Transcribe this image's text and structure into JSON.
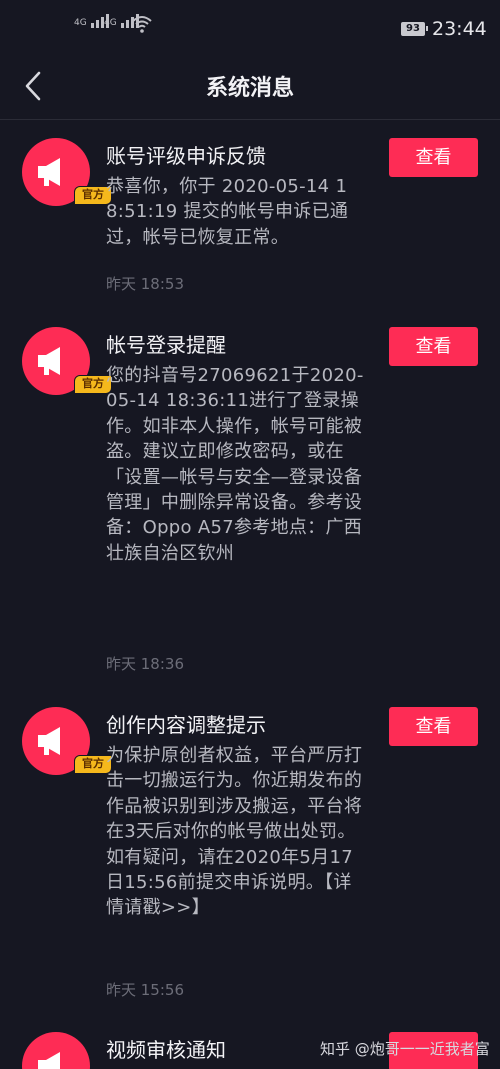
{
  "status": {
    "net1": "4G",
    "net2": "4G",
    "battery": "93",
    "time": "23:44"
  },
  "header": {
    "title": "系统消息"
  },
  "badge_label": "官方",
  "view_label": "查看",
  "messages": [
    {
      "title": "账号评级申诉反馈",
      "body": "恭喜你，你于 2020-05-14 18:51:19 提交的帐号申诉已通过，帐号已恢复正常。",
      "time": "昨天 18:53"
    },
    {
      "title": "帐号登录提醒",
      "body": "您的抖音号27069621于2020-05-14 18:36:11进行了登录操作。如非本人操作，帐号可能被盗。建议立即修改密码，或在「设置—帐号与安全—登录设备管理」中删除异常设备。参考设备：Oppo A57参考地点：广西壮族自治区钦州",
      "time": "昨天 18:36"
    },
    {
      "title": "创作内容调整提示",
      "body": "为保护原创者权益，平台严厉打击一切搬运行为。你近期发布的作品被识别到涉及搬运，平台将在3天后对你的帐号做出处罚。如有疑问，请在2020年5月17日15:56前提交申诉说明。【详情请戳>>】",
      "time": "昨天 15:56"
    },
    {
      "title": "视频审核通知"
    }
  ],
  "watermark": "知乎 @炮哥一一近我者富"
}
